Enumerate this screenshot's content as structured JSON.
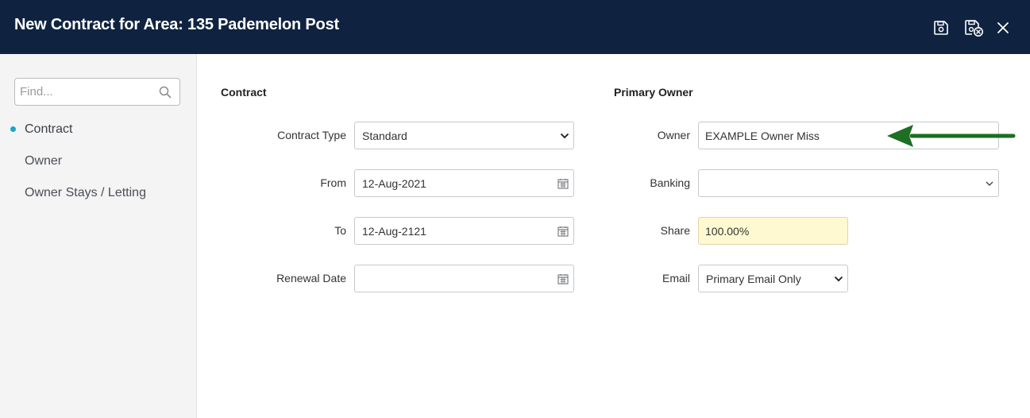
{
  "header": {
    "title": "New Contract for Area: 135 Pademelon Post",
    "save_icon": "save-icon",
    "save_close_icon": "save-close-icon",
    "close_icon": "close-icon"
  },
  "sidebar": {
    "search": {
      "placeholder": "Find...",
      "value": ""
    },
    "items": [
      {
        "label": "Contract",
        "active": true
      },
      {
        "label": "Owner",
        "active": false
      },
      {
        "label": "Owner Stays / Letting",
        "active": false
      }
    ]
  },
  "contract": {
    "section_title": "Contract",
    "contract_type": {
      "label": "Contract Type",
      "value": "Standard"
    },
    "from": {
      "label": "From",
      "value": "12-Aug-2021"
    },
    "to": {
      "label": "To",
      "value": "12-Aug-2121"
    },
    "renewal_date": {
      "label": "Renewal Date",
      "value": ""
    }
  },
  "primary_owner": {
    "section_title": "Primary Owner",
    "owner": {
      "label": "Owner",
      "value": "EXAMPLE Owner Miss"
    },
    "banking": {
      "label": "Banking",
      "value": ""
    },
    "share": {
      "label": "Share",
      "value": "100.00%"
    },
    "email": {
      "label": "Email",
      "value": "Primary Email Only"
    }
  },
  "colors": {
    "header_bg": "#0f2340",
    "active_dot": "#19a8c3",
    "share_highlight": "#fef9d0",
    "annotation_arrow": "#1e6e23"
  }
}
